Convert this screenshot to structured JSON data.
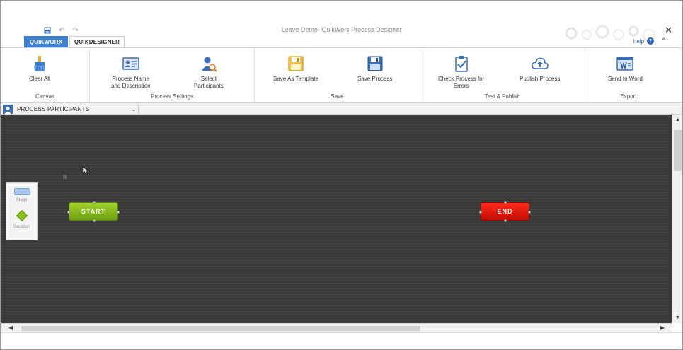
{
  "window": {
    "title": "Leave Demo- QuikWorx Process Designer",
    "close_glyph": "✕"
  },
  "quick_access": {
    "save_icon": "save-icon",
    "undo_glyph": "↶",
    "redo_glyph": "↷"
  },
  "tabs": [
    {
      "label": "QUIKWORX",
      "active": false
    },
    {
      "label": "QUIKDESIGNER",
      "active": true
    }
  ],
  "help": {
    "label": "help",
    "icon_glyph": "?",
    "collapse_glyph": "⌃"
  },
  "ribbon": {
    "groups": [
      {
        "label": "Canvas",
        "buttons": [
          {
            "label": "Clear All",
            "icon": "brush-icon"
          }
        ]
      },
      {
        "label": "Process Settings",
        "buttons": [
          {
            "label": "Process Name\nand Description",
            "icon": "id-card-icon"
          },
          {
            "label": "Select\nParticipants",
            "icon": "participants-icon"
          }
        ]
      },
      {
        "label": "Save",
        "buttons": [
          {
            "label": "Save As Template",
            "icon": "save-template-icon"
          },
          {
            "label": "Save Process",
            "icon": "save-process-icon"
          }
        ]
      },
      {
        "label": "Test & Publish",
        "buttons": [
          {
            "label": "Check Process for\nErrors",
            "icon": "checklist-icon"
          },
          {
            "label": "Publish Process",
            "icon": "cloud-upload-icon"
          }
        ]
      },
      {
        "label": "Export",
        "buttons": [
          {
            "label": "Send to Word",
            "icon": "word-icon"
          }
        ]
      }
    ]
  },
  "participants": {
    "label": "PROCESS PARTICIPANTS",
    "chevron_glyph": "⌄"
  },
  "palette": {
    "items": [
      {
        "label": "Stage",
        "shape": "rectangle"
      },
      {
        "label": "Decision",
        "shape": "diamond"
      }
    ]
  },
  "nodes": {
    "start": {
      "label": "START",
      "color": "#7cb518"
    },
    "end": {
      "label": "END",
      "color": "#e81405"
    }
  },
  "scrollbars": {
    "up_glyph": "▲",
    "down_glyph": "▼",
    "left_glyph": "◀",
    "right_glyph": "▶"
  },
  "colors": {
    "canvas": "#3a3a38",
    "tab_accent": "#3f7fd0"
  }
}
